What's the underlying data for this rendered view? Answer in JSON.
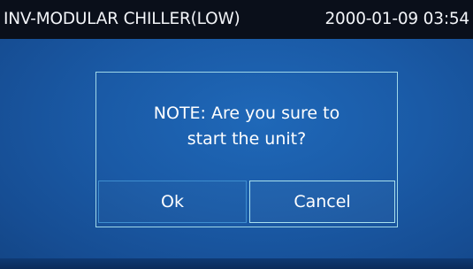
{
  "header": {
    "title": "INV-MODULAR CHILLER(LOW)",
    "datetime": "2000-01-09 03:54"
  },
  "dialog": {
    "message_line1": "NOTE: Are you sure to",
    "message_line2": "start the unit?",
    "ok_label": "Ok",
    "cancel_label": "Cancel"
  },
  "colors": {
    "background": "#1a5aa6",
    "title_bar": "#0a0f1a",
    "dialog_border": "#9fd7e8",
    "text": "#ffffff"
  }
}
